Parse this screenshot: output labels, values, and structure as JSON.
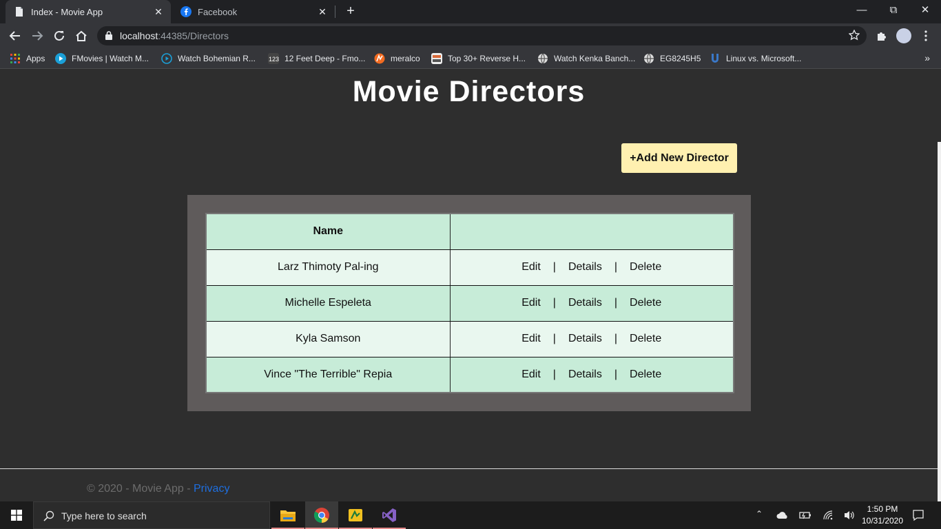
{
  "browser": {
    "tabs": [
      {
        "title": "Index - Movie App",
        "icon": "document-icon",
        "active": true
      },
      {
        "title": "Facebook",
        "icon": "facebook-icon",
        "active": false
      }
    ],
    "url": {
      "host": "localhost",
      "rest": ":44385/Directors"
    },
    "bookmarks": [
      {
        "label": "Apps",
        "icon": "apps-grid-icon",
        "color": "#e8453c"
      },
      {
        "label": "FMovies | Watch M...",
        "icon": "play-icon",
        "color": "#1ba0d8"
      },
      {
        "label": "Watch Bohemian R...",
        "icon": "play-circle-icon",
        "color": "#1ba0d8"
      },
      {
        "label": "12 Feet Deep - Fmo...",
        "icon": "123-icon",
        "color": "#444444"
      },
      {
        "label": "meralco",
        "icon": "meralco-icon",
        "color": "#f26b21"
      },
      {
        "label": "Top 30+ Reverse H...",
        "icon": "image-icon",
        "color": "#d96a3a"
      },
      {
        "label": "Watch Kenka Banch...",
        "icon": "globe-icon",
        "color": "#cccccc"
      },
      {
        "label": "EG8245H5",
        "icon": "globe-icon",
        "color": "#cccccc"
      },
      {
        "label": "Linux vs. Microsoft...",
        "icon": "magnet-icon",
        "color": "#3a78c8"
      }
    ]
  },
  "page": {
    "title": "Movie Directors",
    "add_button": "+Add New Director",
    "table": {
      "headers": [
        "Name",
        ""
      ],
      "rows": [
        {
          "name": "Larz Thimoty Pal-ing"
        },
        {
          "name": "Michelle Espeleta"
        },
        {
          "name": "Kyla Samson"
        },
        {
          "name": "Vince \"The Terrible\" Repia"
        }
      ],
      "actions": {
        "edit": "Edit",
        "details": "Details",
        "delete": "Delete",
        "separator": "|"
      }
    },
    "footer": {
      "text": "© 2020 - Movie App - ",
      "privacy": "Privacy"
    }
  },
  "taskbar": {
    "search_placeholder": "Type here to search",
    "time": "1:50 PM",
    "date": "10/31/2020"
  }
}
